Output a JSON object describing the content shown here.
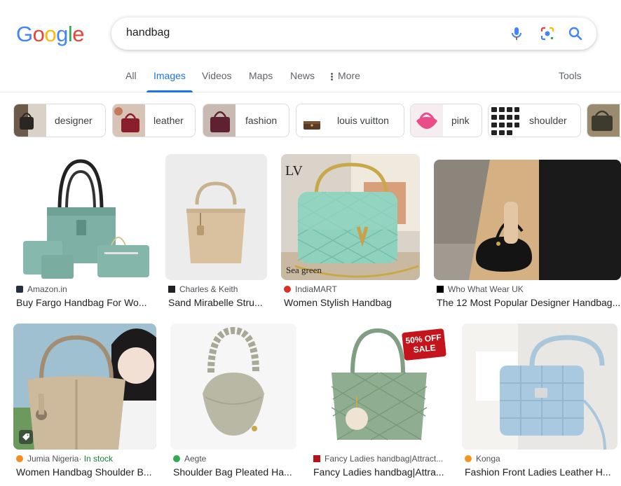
{
  "logo": {
    "letters": [
      "G",
      "o",
      "o",
      "g",
      "l",
      "e"
    ],
    "colors": [
      "#4285F4",
      "#EA4335",
      "#FBBC05",
      "#4285F4",
      "#34A853",
      "#EA4335"
    ]
  },
  "search": {
    "query": "handbag"
  },
  "icons": {
    "mic": "mic-icon",
    "lens": "google-lens-icon",
    "search": "search-icon"
  },
  "tabs": {
    "all": "All",
    "images": "Images",
    "videos": "Videos",
    "maps": "Maps",
    "news": "News",
    "more": "More",
    "tools": "Tools"
  },
  "chips": [
    {
      "label": "designer"
    },
    {
      "label": "leather"
    },
    {
      "label": "fashion"
    },
    {
      "label": "louis vuitton"
    },
    {
      "label": "pink"
    },
    {
      "label": "shoulder"
    }
  ],
  "results": [
    {
      "source": "Amazon.in",
      "title": "Buy Fargo Handbag For Wo...",
      "fav_color": "#232f3e"
    },
    {
      "source": "Charles & Keith",
      "title": "Sand Mirabelle Stru...",
      "fav_color": "#202124"
    },
    {
      "source": "IndiaMART",
      "title": "Women Stylish Handbag",
      "fav_color": "#d93025",
      "overlay": "Sea green"
    },
    {
      "source": "Who What Wear UK",
      "title": "The 12 Most Popular Designer Handbag...",
      "fav_color": "#000000"
    },
    {
      "source": "Jumia Nigeria",
      "source_extra": " · In stock",
      "title": "Women Handbag Shoulder B...",
      "fav_color": "#f68b1e"
    },
    {
      "source": "Aegte",
      "title": "Shoulder Bag Pleated Ha...",
      "fav_color": "#34a853"
    },
    {
      "source": "Fancy Ladies handbag|Attract...",
      "title": "Fancy Ladies handbag|Attra...",
      "fav_color": "#b31217",
      "badge": "50% OFF SALE"
    },
    {
      "source": "Konga",
      "title": "Fashion Front Ladies Leather H...",
      "fav_color": "#f7941d"
    }
  ],
  "colors": {
    "accent": "#1a73e8",
    "border": "#dadce0",
    "text": "#202124",
    "muted": "#5f6368"
  }
}
